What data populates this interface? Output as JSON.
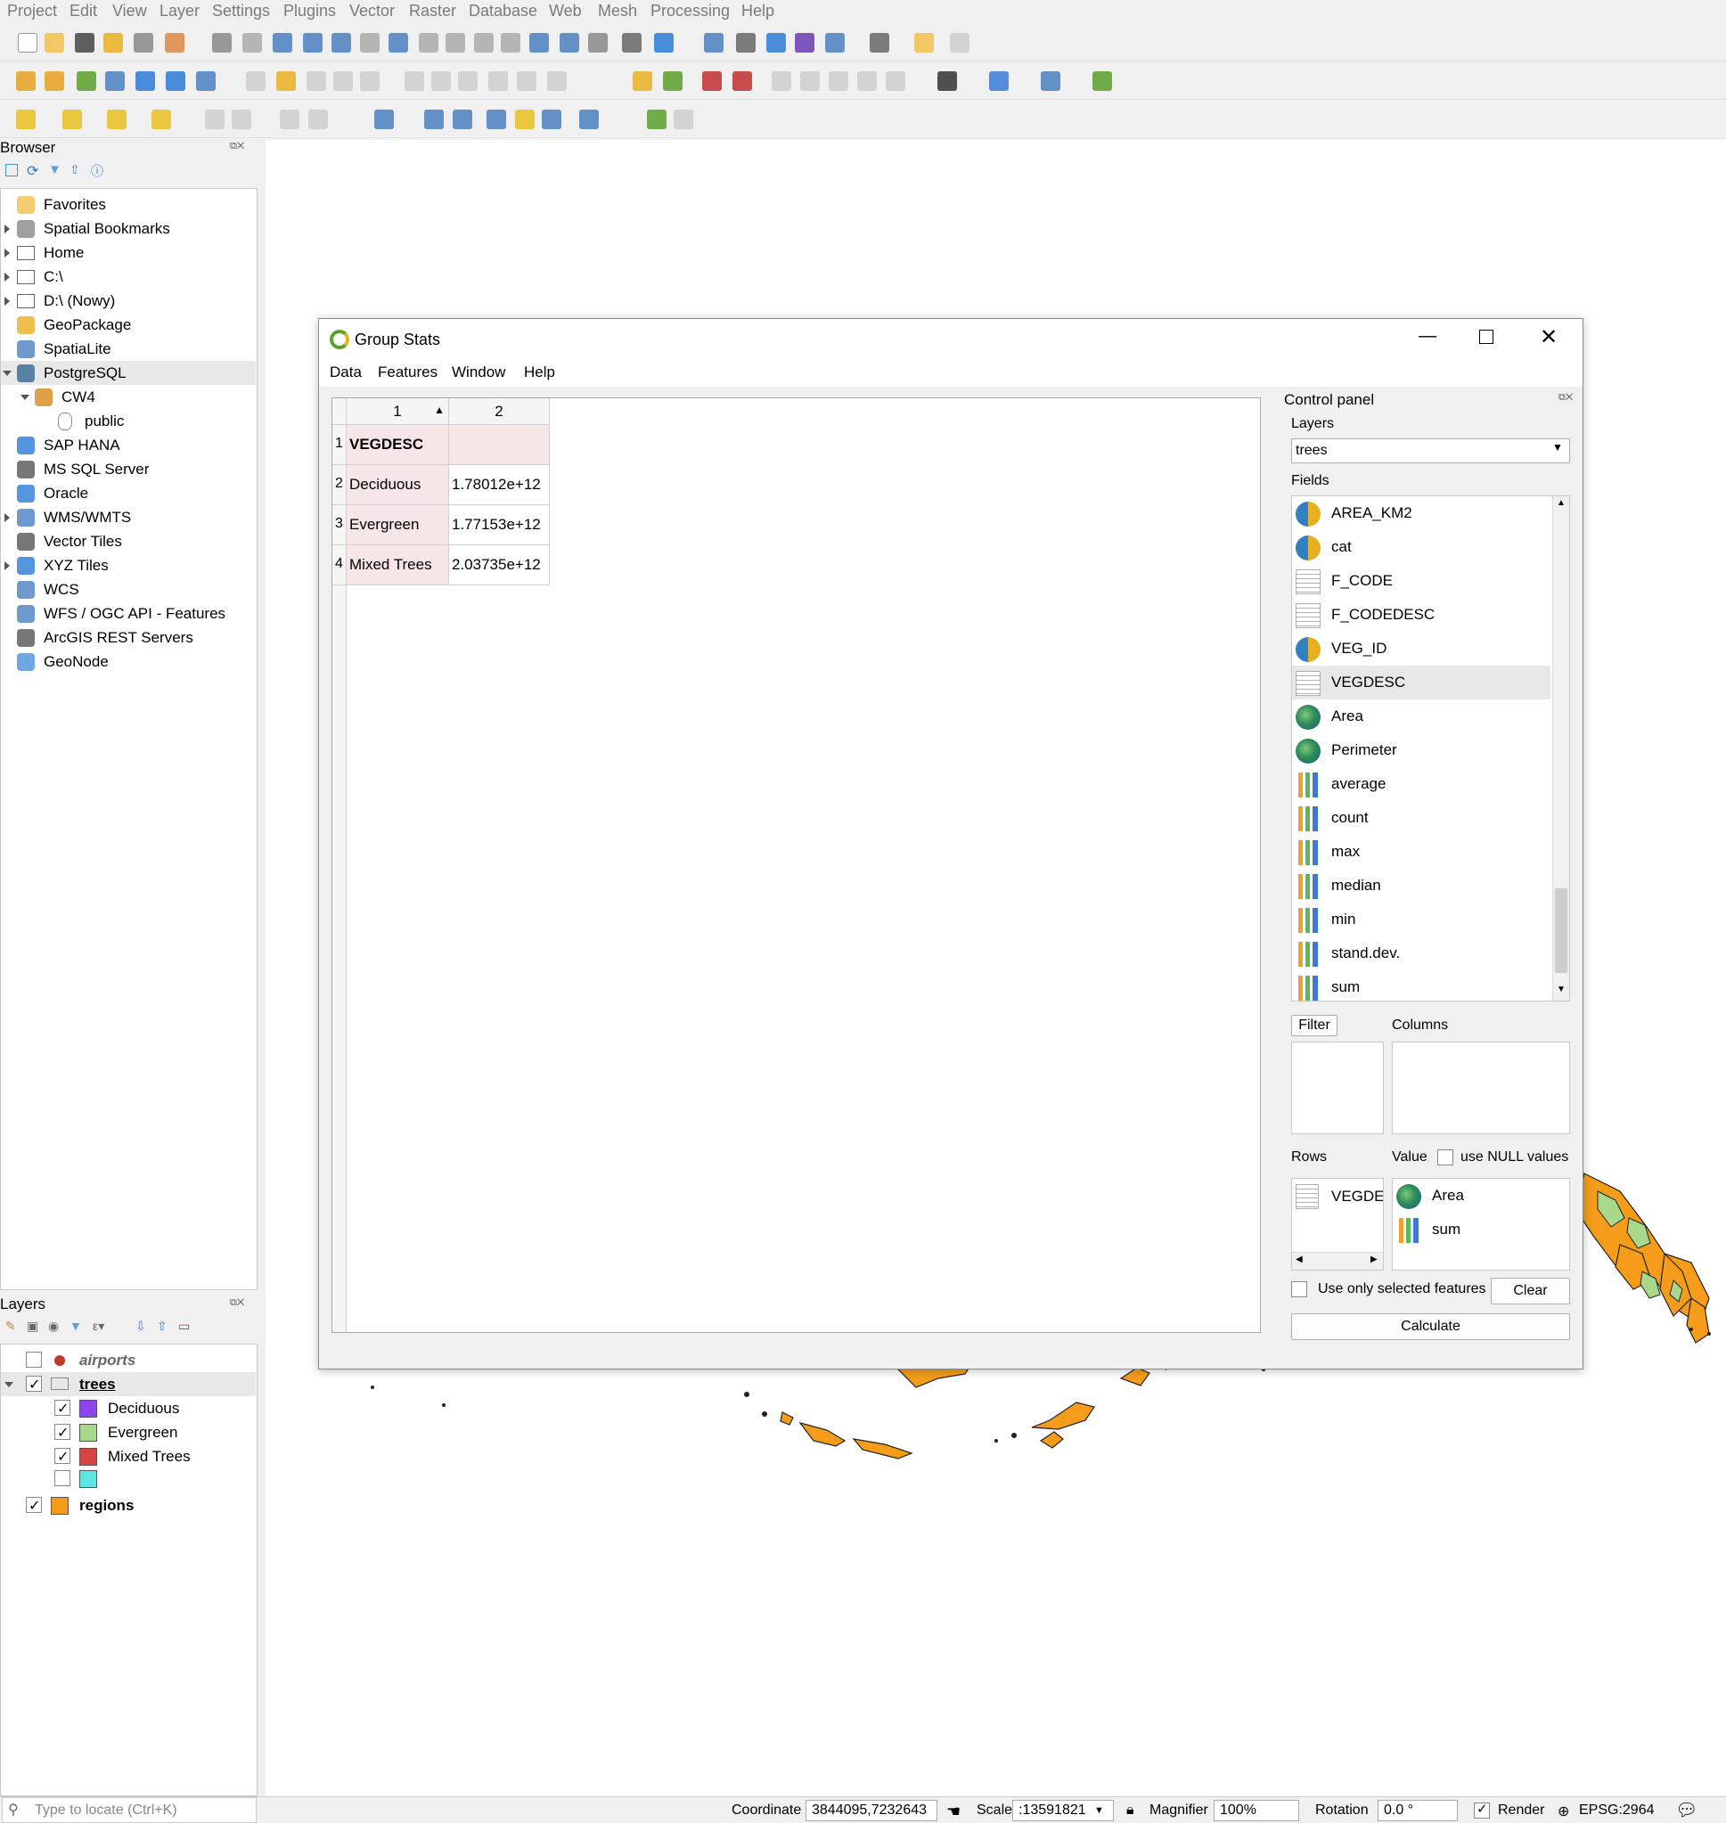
{
  "menu": [
    "Project",
    "Edit",
    "View",
    "Layer",
    "Settings",
    "Plugins",
    "Vector",
    "Raster",
    "Database",
    "Web",
    "Mesh",
    "Processing",
    "Help"
  ],
  "browser": {
    "title": "Browser",
    "items": [
      {
        "label": "Favorites",
        "icon": "star-icon",
        "expander": "none"
      },
      {
        "label": "Spatial Bookmarks",
        "icon": "bookmark-icon",
        "expander": "closed"
      },
      {
        "label": "Home",
        "icon": "home-folder-icon",
        "expander": "closed"
      },
      {
        "label": "C:\\",
        "icon": "folder-icon",
        "expander": "closed"
      },
      {
        "label": "D:\\ (Nowy)",
        "icon": "folder-icon",
        "expander": "closed"
      },
      {
        "label": "GeoPackage",
        "icon": "geopackage-icon",
        "expander": "none"
      },
      {
        "label": "SpatiaLite",
        "icon": "spatialite-icon",
        "expander": "none"
      },
      {
        "label": "PostgreSQL",
        "icon": "postgresql-icon",
        "expander": "open"
      },
      {
        "label": "CW4",
        "icon": "connection-icon",
        "expander": "open"
      },
      {
        "label": "public",
        "icon": "schema-icon",
        "expander": "none"
      },
      {
        "label": "SAP HANA",
        "icon": "sap-hana-icon",
        "expander": "none"
      },
      {
        "label": "MS SQL Server",
        "icon": "mssql-icon",
        "expander": "none"
      },
      {
        "label": "Oracle",
        "icon": "oracle-icon",
        "expander": "none"
      },
      {
        "label": "WMS/WMTS",
        "icon": "wms-icon",
        "expander": "closed"
      },
      {
        "label": "Vector Tiles",
        "icon": "vector-tiles-icon",
        "expander": "none"
      },
      {
        "label": "XYZ Tiles",
        "icon": "xyz-tiles-icon",
        "expander": "closed"
      },
      {
        "label": "WCS",
        "icon": "wcs-icon",
        "expander": "none"
      },
      {
        "label": "WFS / OGC API - Features",
        "icon": "wfs-icon",
        "expander": "none"
      },
      {
        "label": "ArcGIS REST Servers",
        "icon": "arcgis-icon",
        "expander": "none"
      },
      {
        "label": "GeoNode",
        "icon": "geonode-icon",
        "expander": "none"
      }
    ]
  },
  "layers": {
    "title": "Layers",
    "items": [
      {
        "label": "airports",
        "checked": false,
        "color": "#c0392b",
        "style": "italic"
      },
      {
        "label": "trees",
        "checked": true,
        "color": "",
        "style": "bold-underline"
      },
      {
        "label": "Deciduous",
        "checked": true,
        "color": "#8e44ec",
        "style": "normal"
      },
      {
        "label": "Evergreen",
        "checked": true,
        "color": "#a8d88a",
        "style": "normal"
      },
      {
        "label": "Mixed Trees",
        "checked": true,
        "color": "#d64545",
        "style": "normal"
      },
      {
        "label": "",
        "checked": false,
        "color": "#5ee6e0",
        "style": "normal"
      },
      {
        "label": "regions",
        "checked": true,
        "color": "#f59d1a",
        "style": "bold"
      }
    ]
  },
  "dialog": {
    "title": "Group Stats",
    "menu": [
      "Data",
      "Features",
      "Window",
      "Help"
    ],
    "table": {
      "col_headers": [
        "1",
        "2"
      ],
      "row_headers": [
        "1",
        "2",
        "3",
        "4"
      ],
      "rows": [
        [
          "VEGDESC",
          ""
        ],
        [
          "Deciduous",
          "1.78012e+12"
        ],
        [
          "Evergreen",
          "1.77153e+12"
        ],
        [
          "Mixed Trees",
          "2.03735e+12"
        ]
      ]
    },
    "control_panel": {
      "title": "Control panel",
      "layers_label": "Layers",
      "layer_value": "trees",
      "fields_label": "Fields",
      "fields": [
        {
          "name": "AREA_KM2",
          "type": "pie"
        },
        {
          "name": "cat",
          "type": "pie"
        },
        {
          "name": "F_CODE",
          "type": "text"
        },
        {
          "name": "F_CODEDESC",
          "type": "text"
        },
        {
          "name": "VEG_ID",
          "type": "pie"
        },
        {
          "name": "VEGDESC",
          "type": "text"
        },
        {
          "name": "Area",
          "type": "globe"
        },
        {
          "name": "Perimeter",
          "type": "globe"
        },
        {
          "name": "average",
          "type": "bars"
        },
        {
          "name": "count",
          "type": "bars"
        },
        {
          "name": "max",
          "type": "bars"
        },
        {
          "name": "median",
          "type": "bars"
        },
        {
          "name": "min",
          "type": "bars"
        },
        {
          "name": "stand.dev.",
          "type": "bars"
        },
        {
          "name": "sum",
          "type": "bars"
        }
      ],
      "filter_label": "Filter",
      "columns_label": "Columns",
      "rows_label": "Rows",
      "rows_value": "VEGDE!",
      "value_label": "Value",
      "use_null_label": "use NULL values",
      "value_items": [
        {
          "name": "Area",
          "type": "globe"
        },
        {
          "name": "sum",
          "type": "bars"
        }
      ],
      "selected_only_label": "Use only selected features",
      "clear_label": "Clear",
      "calculate_label": "Calculate"
    }
  },
  "status": {
    "locate_placeholder": "Type to locate (Ctrl+K)",
    "coordinate_label": "Coordinate",
    "coordinate_value": "3844095,7232643",
    "scale_label": "Scale",
    "scale_value": ":13591821",
    "magnifier_label": "Magnifier",
    "magnifier_value": "100%",
    "rotation_label": "Rotation",
    "rotation_value": "0.0 °",
    "render_label": "Render",
    "crs": "EPSG:2964"
  }
}
